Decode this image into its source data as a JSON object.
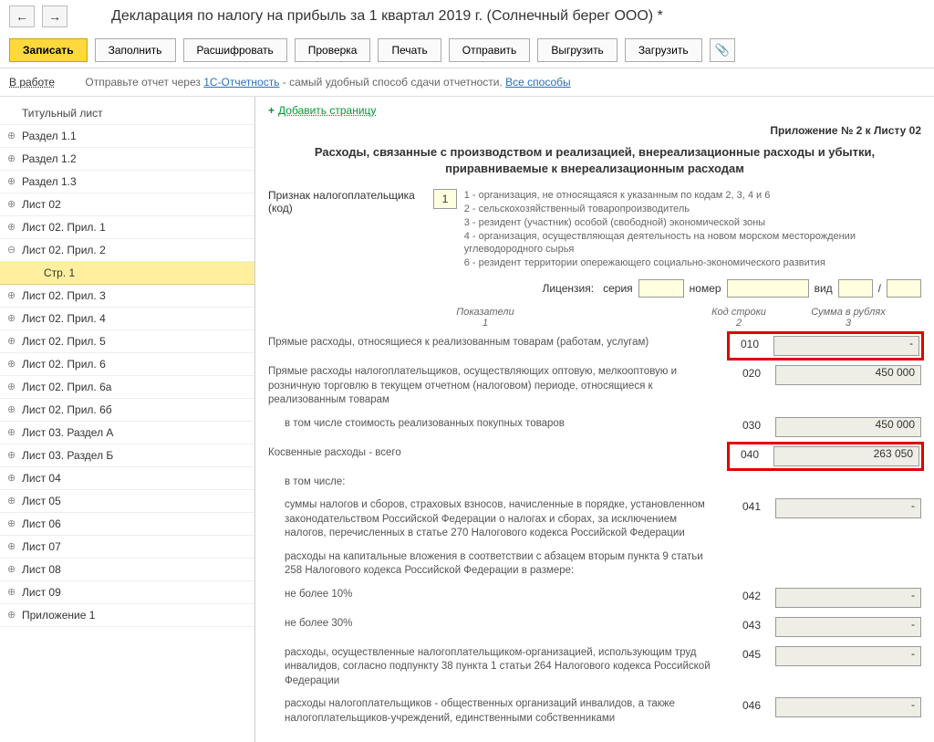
{
  "nav": {
    "back": "←",
    "fwd": "→"
  },
  "title": "Декларация по налогу на прибыль за 1 квартал 2019 г. (Солнечный берег ООО) *",
  "toolbar": {
    "write": "Записать",
    "fill": "Заполнить",
    "decode": "Расшифровать",
    "check": "Проверка",
    "print": "Печать",
    "send": "Отправить",
    "export": "Выгрузить",
    "load": "Загрузить",
    "clip": "📎"
  },
  "infobar": {
    "status": "В работе",
    "text1": "Отправьте отчет через ",
    "link1": "1С-Отчетность",
    "text2": " - самый удобный способ сдачи отчетности. ",
    "link2": "Все способы"
  },
  "sidebar": {
    "header": "Титульный лист",
    "items": [
      {
        "label": "Раздел 1.1"
      },
      {
        "label": "Раздел 1.2"
      },
      {
        "label": "Раздел 1.3"
      },
      {
        "label": "Лист 02"
      },
      {
        "label": "Лист 02. Прил. 1"
      },
      {
        "label": "Лист 02. Прил. 2",
        "open": true
      },
      {
        "label": "Стр. 1",
        "child": true
      },
      {
        "label": "Лист 02. Прил. 3"
      },
      {
        "label": "Лист 02. Прил. 4"
      },
      {
        "label": "Лист 02. Прил. 5"
      },
      {
        "label": "Лист 02. Прил. 6"
      },
      {
        "label": "Лист 02. Прил. 6а"
      },
      {
        "label": "Лист 02. Прил. 6б"
      },
      {
        "label": "Лист 03. Раздел А"
      },
      {
        "label": "Лист 03. Раздел Б"
      },
      {
        "label": "Лист 04"
      },
      {
        "label": "Лист 05"
      },
      {
        "label": "Лист 06"
      },
      {
        "label": "Лист 07"
      },
      {
        "label": "Лист 08"
      },
      {
        "label": "Лист 09"
      },
      {
        "label": "Приложение 1"
      }
    ]
  },
  "main": {
    "add_page": "Добавить страницу",
    "appendix": "Приложение № 2 к Листу 02",
    "section_title": "Расходы, связанные с производством и реализацией, внереализационные расходы и убытки, приравниваемые к внереализационным расходам",
    "taxpayer_label": "Признак налогоплательщика (код)",
    "taxpayer_code": "1",
    "hints": [
      "1 - организация, не относящаяся к указанным по кодам 2, 3, 4 и 6",
      "2 - сельскохозяйственный товаропроизводитель",
      "3 - резидент (участник) особой (свободной) экономической зоны",
      "4 - организация, осуществляющая деятельность на новом морском месторождении углеводородного сырья",
      "6 - резидент территории опережающего социально-экономического развития"
    ],
    "license": {
      "label": "Лицензия:",
      "series": "серия",
      "num": "номер",
      "type": "вид",
      "slash": "/"
    },
    "thead": {
      "c1": "Показатели",
      "c1n": "1",
      "c2": "Код строки",
      "c2n": "2",
      "c3": "Сумма в рублях",
      "c3n": "3"
    },
    "rows": [
      {
        "label": "Прямые расходы, относящиеся к реализованным товарам (работам, услугам)",
        "code": "010",
        "value": "-",
        "hl": true
      },
      {
        "label": "Прямые расходы налогоплательщиков, осуществляющих оптовую, мелкооптовую и розничную торговлю в текущем отчетном (налоговом) периоде, относящиеся к реализованным товарам",
        "code": "020",
        "value": "450 000"
      },
      {
        "label": "в том числе стоимость реализованных покупных товаров",
        "code": "030",
        "value": "450 000",
        "indent": true
      },
      {
        "label": "Косвенные расходы - всего",
        "code": "040",
        "value": "263 050",
        "hl": true
      },
      {
        "label": "в том числе:",
        "code": "",
        "value": null,
        "indent": true
      },
      {
        "label": "суммы налогов и сборов, страховых взносов, начисленные в порядке, установленном законодательством Российской Федерации о налогах и сборах, за исключением налогов, перечисленных в статье 270 Налогового кодекса Российской Федерации",
        "code": "041",
        "value": "-",
        "indent": true
      },
      {
        "label": "расходы на капитальные вложения в соответствии с абзацем вторым пункта 9 статьи 258 Налогового кодекса Российской Федерации в размере:",
        "code": "",
        "value": null,
        "indent": true
      },
      {
        "label": "не более 10%",
        "code": "042",
        "value": "-",
        "indent": true
      },
      {
        "label": "не более 30%",
        "code": "043",
        "value": "-",
        "indent": true
      },
      {
        "label": "расходы, осуществленные налогоплательщиком-организацией, использующим труд инвалидов, согласно подпункту 38 пункта 1 статьи 264 Налогового кодекса Российской Федерации",
        "code": "045",
        "value": "-",
        "indent": true
      },
      {
        "label": "расходы налогоплательщиков - общественных организаций инвалидов, а также налогоплательщиков-учреждений, единственными собственниками",
        "code": "046",
        "value": "-",
        "indent": true
      }
    ]
  }
}
